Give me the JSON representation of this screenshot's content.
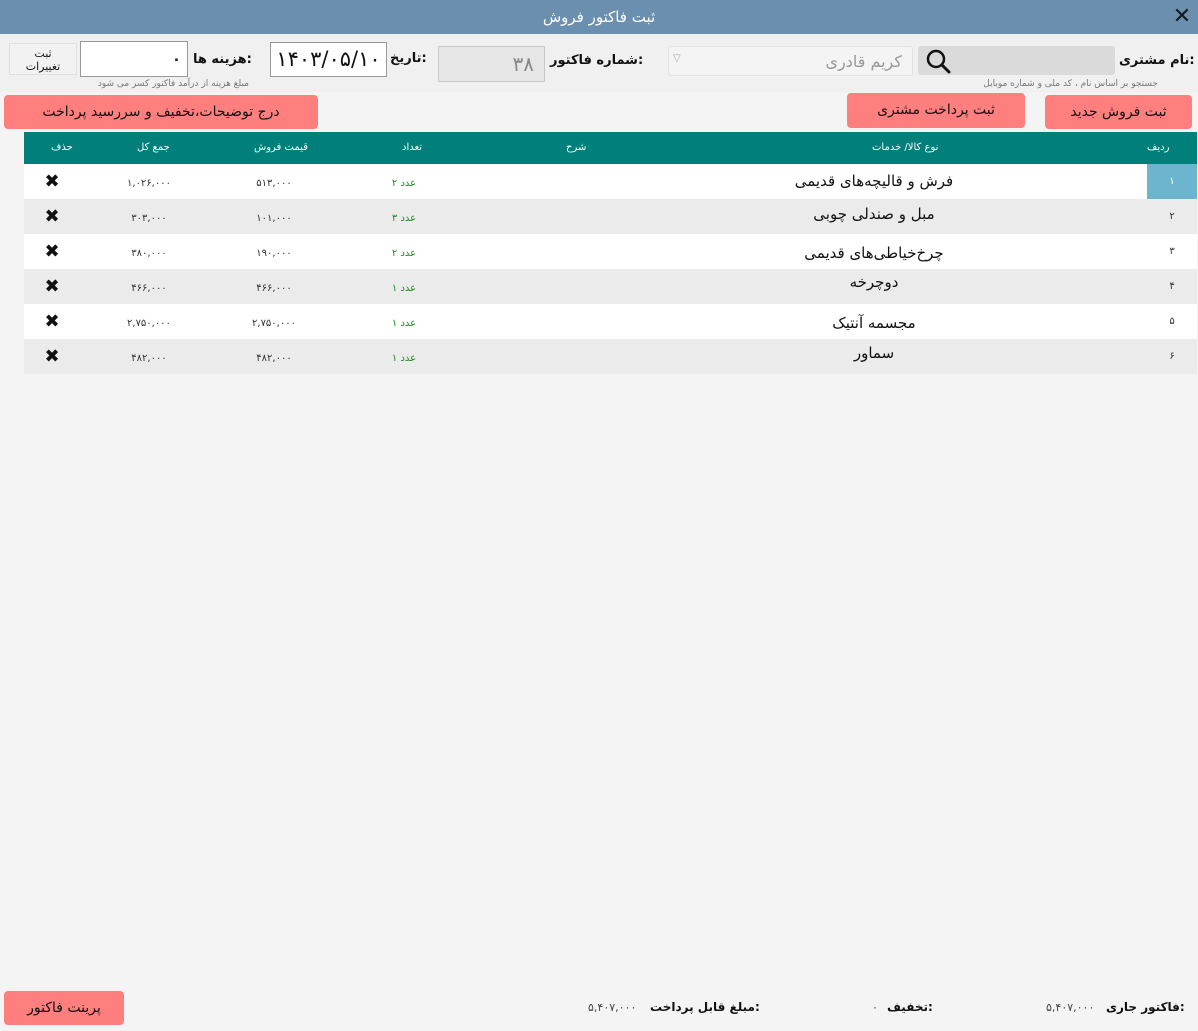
{
  "window": {
    "title": "ثبت فاکتور فروش"
  },
  "header": {
    "customer_label": "نام مشتری:",
    "customer_hint": "جستجو بر اساس نام ، کد ملی و شماره موبایل",
    "customer_value": "کریم قادری",
    "invoice_no_label": "شماره فاکتور:",
    "invoice_no": "۳۸",
    "date_label": "تاریخ:",
    "date_value": "۱۴۰۳/۰۵/۱۰",
    "cost_label": "هزینه ها:",
    "cost_value": "۰",
    "cost_hint": "مبلغ هزینه از درآمد فاکتور کسر می شود",
    "save_changes_label": "ثبت تغییرات"
  },
  "actions": {
    "new_sale": "ثبت فروش جدید",
    "customer_payment": "ثبت پرداخت مشتری",
    "details": "درج توضیحات،تخفیف و سررسید پرداخت",
    "print": "پرینت فاکتور"
  },
  "table": {
    "columns": {
      "row": "ردیف",
      "item_type": "نوع کالا/ خدمات",
      "description": "شرح",
      "qty": "تعداد",
      "price": "قیمت فروش",
      "total": "جمع کل",
      "delete": "حذف"
    },
    "rows": [
      {
        "num": "۱",
        "name": "فرش و قالیچه‌های قدیمی",
        "qty": "۲ عدد",
        "price": "۵۱۳,۰۰۰",
        "total": "۱,۰۲۶,۰۰۰"
      },
      {
        "num": "۲",
        "name": "مبل و صندلی چوبی",
        "qty": "۳ عدد",
        "price": "۱۰۱,۰۰۰",
        "total": "۳۰۳,۰۰۰"
      },
      {
        "num": "۳",
        "name": "چرخ‌خیاطی‌های قدیمی",
        "qty": "۲ عدد",
        "price": "۱۹۰,۰۰۰",
        "total": "۳۸۰,۰۰۰"
      },
      {
        "num": "۴",
        "name": "دوچرخه",
        "qty": "۱ عدد",
        "price": "۴۶۶,۰۰۰",
        "total": "۴۶۶,۰۰۰"
      },
      {
        "num": "۵",
        "name": "مجسمه  آنتیک",
        "qty": "۱ عدد",
        "price": "۲,۷۵۰,۰۰۰",
        "total": "۲,۷۵۰,۰۰۰"
      },
      {
        "num": "۶",
        "name": "سماور",
        "qty": "۱ عدد",
        "price": "۴۸۲,۰۰۰",
        "total": "۴۸۲,۰۰۰"
      }
    ]
  },
  "footer": {
    "current_invoice_label": "فاکتور جاری:",
    "current_invoice_value": "۵,۴۰۷,۰۰۰",
    "discount_label": "تخفیف:",
    "discount_value": "۰",
    "payable_label": "مبلغ قابل پرداخت:",
    "payable_value": "۵,۴۰۷,۰۰۰"
  },
  "colors": {
    "titlebar": "#6b8fae",
    "table_header": "#007f7b",
    "action_button": "#ff7f7f",
    "selected_row_number": "#6db5cf",
    "quantity_text": "#1d8a1d"
  },
  "icons": {
    "close": "close-icon",
    "search": "search-icon",
    "delete": "delete-x-icon",
    "dropdown": "chevron-down-icon"
  }
}
